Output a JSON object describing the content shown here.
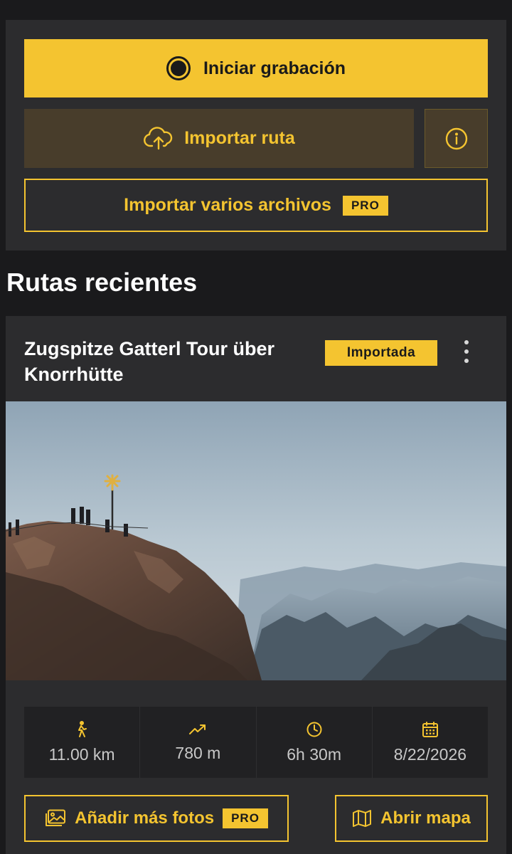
{
  "actions": {
    "record_label": "Iniciar grabación",
    "import_label": "Importar ruta",
    "import_multi_label": "Importar varios archivos",
    "pro_badge": "PRO"
  },
  "recent": {
    "section_title": "Rutas recientes",
    "route": {
      "title": "Zugspitze Gatterl Tour über Knorrhütte",
      "status": "Importada",
      "stats": {
        "distance": "11.00 km",
        "elevation": "780 m",
        "duration": "6h 30m",
        "date": "8/22/2026"
      },
      "add_photos_label": "Añadir más fotos",
      "add_photos_badge": "PRO",
      "open_map_label": "Abrir mapa"
    }
  },
  "colors": {
    "accent": "#f4c430",
    "background": "#1a1a1c",
    "card": "#2c2c2e"
  },
  "icons": [
    "record-icon",
    "cloud-upload-icon",
    "info-icon",
    "more-vertical-icon",
    "hiker-icon",
    "trending-up-icon",
    "clock-icon",
    "calendar-icon",
    "image-icon",
    "map-icon"
  ]
}
